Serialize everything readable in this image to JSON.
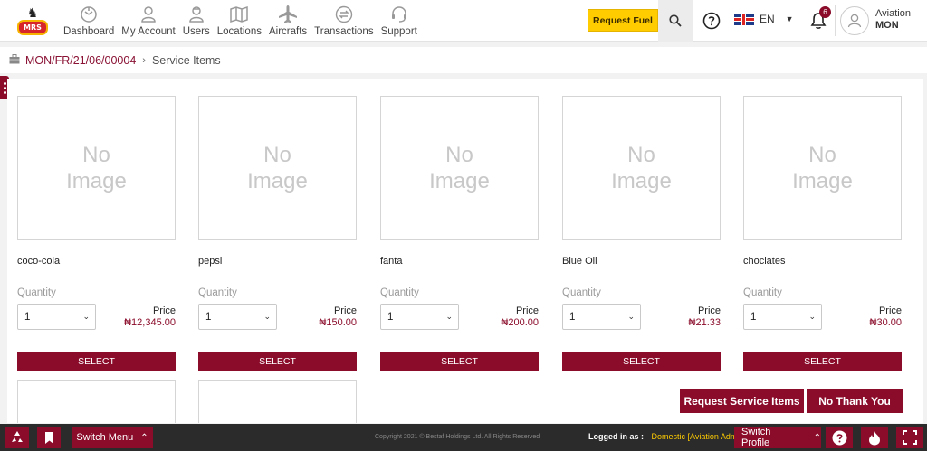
{
  "brand": {
    "logo_text": "MRS"
  },
  "nav": {
    "items": [
      {
        "label": "Dashboard"
      },
      {
        "label": "My Account"
      },
      {
        "label": "Users"
      },
      {
        "label": "Locations"
      },
      {
        "label": "Aircrafts"
      },
      {
        "label": "Transactions"
      },
      {
        "label": "Support"
      }
    ],
    "request_fuel": "Request Fuel",
    "language": "EN",
    "notification_count": "6",
    "user": {
      "name": "Aviation",
      "org": "MON"
    }
  },
  "breadcrumb": {
    "order": "MON/FR/21/06/00004",
    "current": "Service Items"
  },
  "products": [
    {
      "image_text_1": "No",
      "image_text_2": "Image",
      "name": "coco-cola",
      "quantity_label": "Quantity",
      "quantity": "1",
      "price_label": "Price",
      "price": "₦12,345.00",
      "select_label": "SELECT"
    },
    {
      "image_text_1": "No",
      "image_text_2": "Image",
      "name": "pepsi",
      "quantity_label": "Quantity",
      "quantity": "1",
      "price_label": "Price",
      "price": "₦150.00",
      "select_label": "SELECT"
    },
    {
      "image_text_1": "No",
      "image_text_2": "Image",
      "name": "fanta",
      "quantity_label": "Quantity",
      "quantity": "1",
      "price_label": "Price",
      "price": "₦200.00",
      "select_label": "SELECT"
    },
    {
      "image_text_1": "No",
      "image_text_2": "Image",
      "name": "Blue Oil",
      "quantity_label": "Quantity",
      "quantity": "1",
      "price_label": "Price",
      "price": "₦21.33",
      "select_label": "SELECT"
    },
    {
      "image_text_1": "No",
      "image_text_2": "Image",
      "name": "choclates",
      "quantity_label": "Quantity",
      "quantity": "1",
      "price_label": "Price",
      "price": "₦30.00",
      "select_label": "SELECT"
    }
  ],
  "actions": {
    "request": "Request Service Items",
    "decline": "No Thank You"
  },
  "footer": {
    "switch_menu": "Switch Menu",
    "copyright": "Copyright 2021 © Bestaf Holdings Ltd. All Rights Reserved",
    "logged_in_label": "Logged in as :",
    "logged_in_user": "Domestic [Aviation Admin]",
    "switch_profile": "Switch Profile"
  },
  "colors": {
    "brand": "#8a0b2a",
    "accent": "#ffcc00"
  }
}
